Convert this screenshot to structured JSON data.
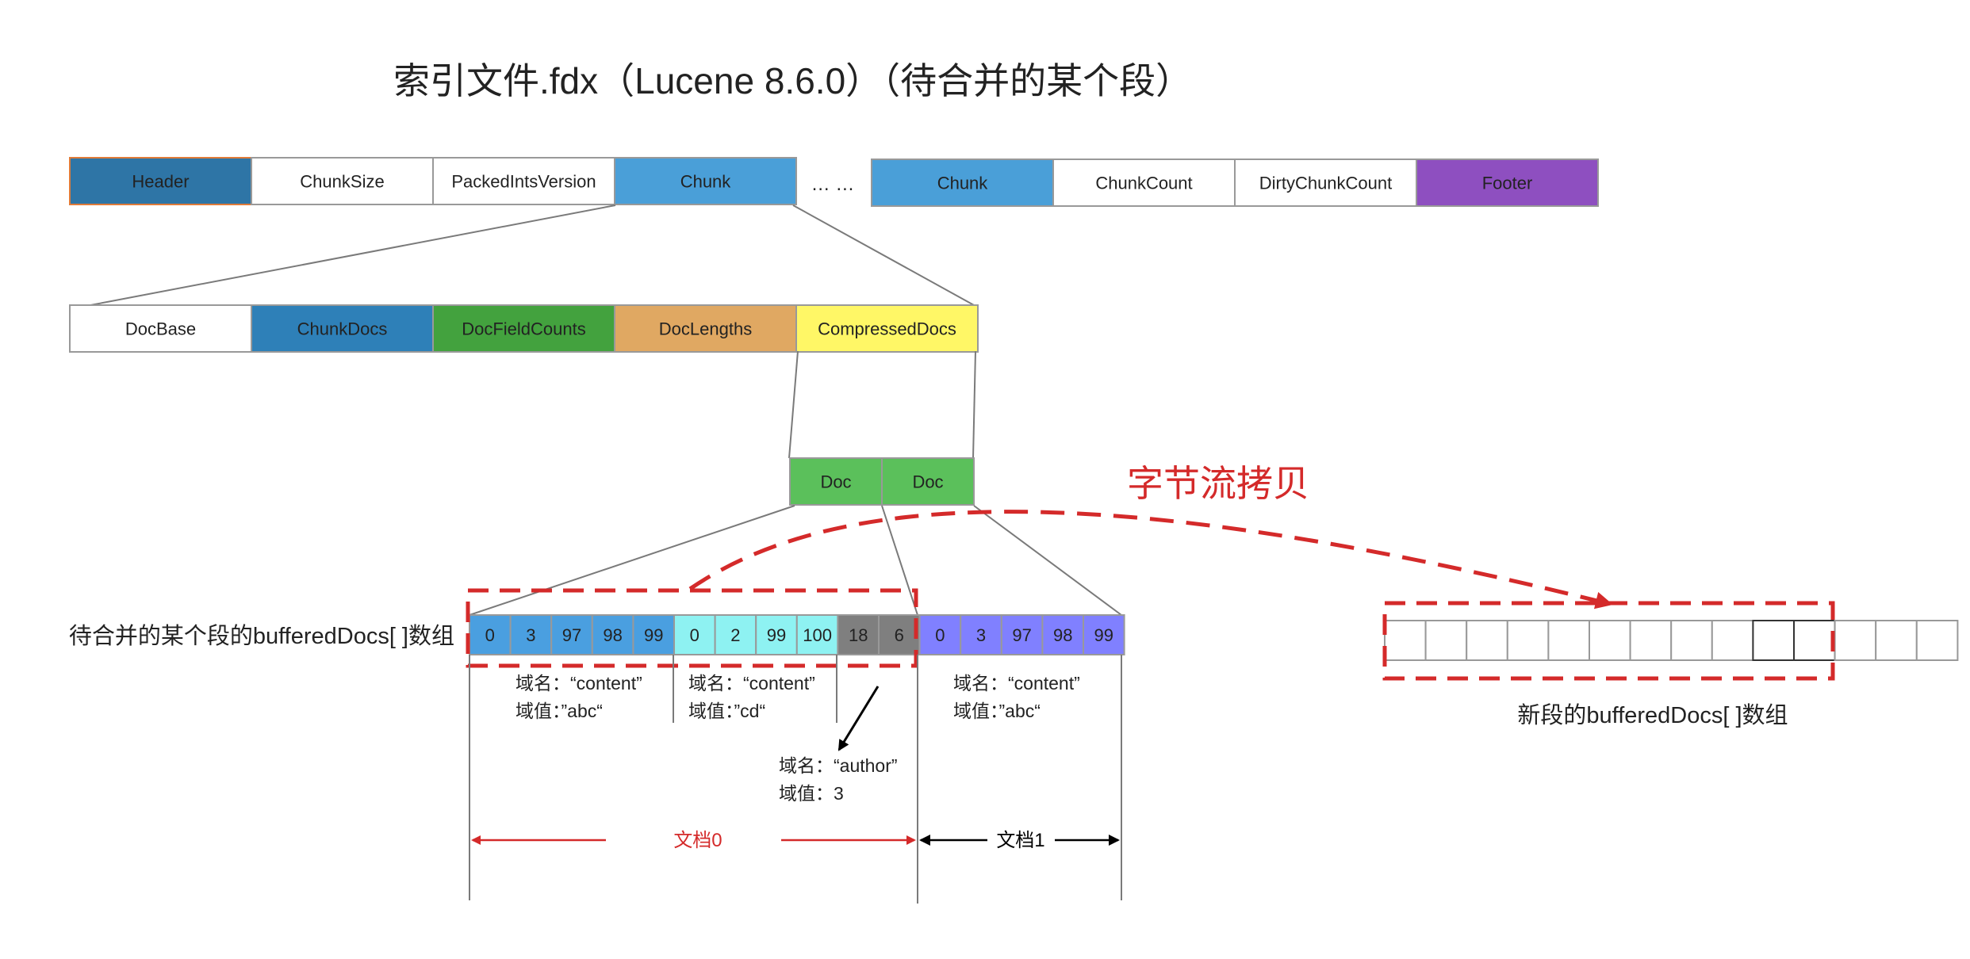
{
  "title": "索引文件.fdx（Lucene 8.6.0）（待合并的某个段）",
  "top_row": {
    "cells": [
      {
        "label": "Header",
        "fill": "#2e75a6",
        "stroke": "#e07b39"
      },
      {
        "label": "ChunkSize",
        "fill": "#ffffff",
        "stroke": "#999999"
      },
      {
        "label": "PackedIntsVersion",
        "fill": "#ffffff",
        "stroke": "#999999"
      },
      {
        "label": "Chunk",
        "fill": "#4a9fd8",
        "stroke": "#999999"
      }
    ],
    "ellipsis": "… …",
    "cells_right": [
      {
        "label": "Chunk",
        "fill": "#4a9fd8",
        "stroke": "#999999"
      },
      {
        "label": "ChunkCount",
        "fill": "#ffffff",
        "stroke": "#999999"
      },
      {
        "label": "DirtyChunkCount",
        "fill": "#ffffff",
        "stroke": "#999999"
      },
      {
        "label": "Footer",
        "fill": "#8e4fc0",
        "stroke": "#999999"
      }
    ]
  },
  "chunk_row": {
    "cells": [
      {
        "label": "DocBase",
        "fill": "#ffffff"
      },
      {
        "label": "ChunkDocs",
        "fill": "#2e80b8"
      },
      {
        "label": "DocFieldCounts",
        "fill": "#43a23e"
      },
      {
        "label": "DocLengths",
        "fill": "#e0a862"
      },
      {
        "label": "CompressedDocs",
        "fill": "#fff766"
      }
    ]
  },
  "doc_row": {
    "cells": [
      {
        "label": "Doc",
        "fill": "#5bc05b"
      },
      {
        "label": "Doc",
        "fill": "#5bc05b"
      }
    ]
  },
  "copy_label": "字节流拷贝",
  "buffer": {
    "label": "待合并的某个段的bufferedDocs[ ]数组",
    "cells": [
      {
        "value": "0",
        "fill": "#4a9fe0"
      },
      {
        "value": "3",
        "fill": "#4a9fe0"
      },
      {
        "value": "97",
        "fill": "#4a9fe0"
      },
      {
        "value": "98",
        "fill": "#4a9fe0"
      },
      {
        "value": "99",
        "fill": "#4a9fe0"
      },
      {
        "value": "0",
        "fill": "#8ef2f2"
      },
      {
        "value": "2",
        "fill": "#8ef2f2"
      },
      {
        "value": "99",
        "fill": "#8ef2f2"
      },
      {
        "value": "100",
        "fill": "#8ef2f2"
      },
      {
        "value": "18",
        "fill": "#7f7f7f"
      },
      {
        "value": "6",
        "fill": "#7f7f7f"
      },
      {
        "value": "0",
        "fill": "#8080ff"
      },
      {
        "value": "3",
        "fill": "#8080ff"
      },
      {
        "value": "97",
        "fill": "#8080ff"
      },
      {
        "value": "98",
        "fill": "#8080ff"
      },
      {
        "value": "99",
        "fill": "#8080ff"
      }
    ]
  },
  "annotations": {
    "f1_name": "域名：“content”",
    "f1_value": "域值：”abc“",
    "f2_name": "域名：“content”",
    "f2_value": "域值：”cd“",
    "f3_name": "域名：“author”",
    "f3_value": "域值：3",
    "f4_name": "域名：“content”",
    "f4_value": "域值：”abc“"
  },
  "doc_labels": {
    "doc0": "文档0",
    "doc1": "文档1"
  },
  "new_buffer": {
    "label": "新段的bufferedDocs[ ]数组",
    "cell_count": 14
  },
  "colors": {
    "accent_red": "#d42a2a",
    "line_gray": "#7a7a7a",
    "cell_border": "#999999"
  }
}
